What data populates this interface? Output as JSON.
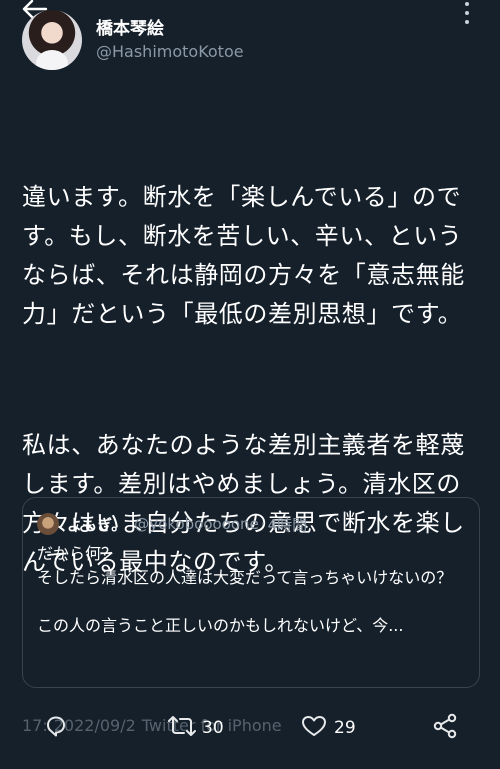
{
  "header": {
    "display_name": "橋本琴絵",
    "handle": "@HashimotoKotoe"
  },
  "tweet": {
    "paragraph_1": "違います。断水を「楽しんでいる」のです。もし、断水を苦しい、辛い、というならば、それは静岡の方々を「意志無能力」だという「最低の差別思想」です。",
    "paragraph_2": "私は、あなたのような差別主義者を軽蔑します。差別はやめましょう。清水区の方々はいま自分たちの意思で断水を楽しんでいる最中なのです。"
  },
  "quote": {
    "name": "よもぎ。",
    "handle": "@yokobooooone",
    "separator": "·",
    "time": "4時間",
    "text": "だから何？\nそしたら清水区の人達は大変だって言っちゃいけないの？\n\nこの人の言うこと正しいのかもしれないけど、今..."
  },
  "meta": {
    "time": "17:",
    "date": "2022/09/2",
    "via": "Twitter for iPhone"
  },
  "actions": {
    "retweets": "30",
    "likes": "29"
  },
  "colors": {
    "background": "#15202b",
    "secondary_text": "#8b98a5",
    "border": "#38444d"
  }
}
